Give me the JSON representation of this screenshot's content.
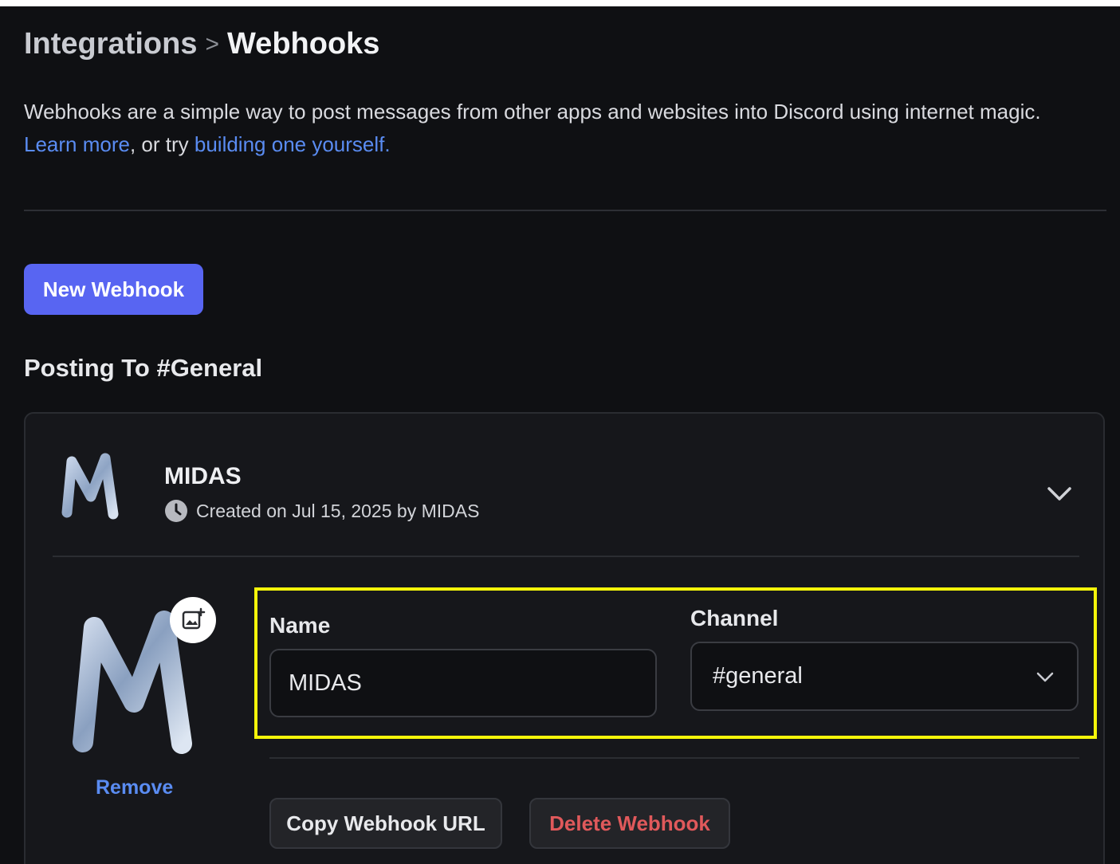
{
  "header": {
    "breadcrumb_parent": "Integrations",
    "breadcrumb_separator": ">",
    "breadcrumb_current": "Webhooks"
  },
  "description": {
    "text": "Webhooks are a simple way to post messages from other apps and websites into Discord using internet magic.",
    "learn_more": "Learn more",
    "or_try": ", or try ",
    "build_link": "building one yourself."
  },
  "new_webhook_label": "New Webhook",
  "posting_to_title": "Posting To #General",
  "webhook": {
    "name": "MIDAS",
    "created_text": "Created on Jul 15, 2025 by MIDAS",
    "remove_label": "Remove",
    "name_label": "Name",
    "name_value": "MIDAS",
    "channel_label": "Channel",
    "channel_value": "#general",
    "copy_url_label": "Copy Webhook URL",
    "delete_label": "Delete Webhook"
  },
  "icons": {
    "clock": "clock-icon",
    "collapse": "chevron-up-icon",
    "select": "chevron-down-icon",
    "upload": "image-add-icon"
  },
  "colors": {
    "background": "#0f1013",
    "card": "#16171b",
    "brand": "#5865f2",
    "link": "#5a8cf2",
    "danger": "#e0595b",
    "highlight": "#f5f50a"
  }
}
